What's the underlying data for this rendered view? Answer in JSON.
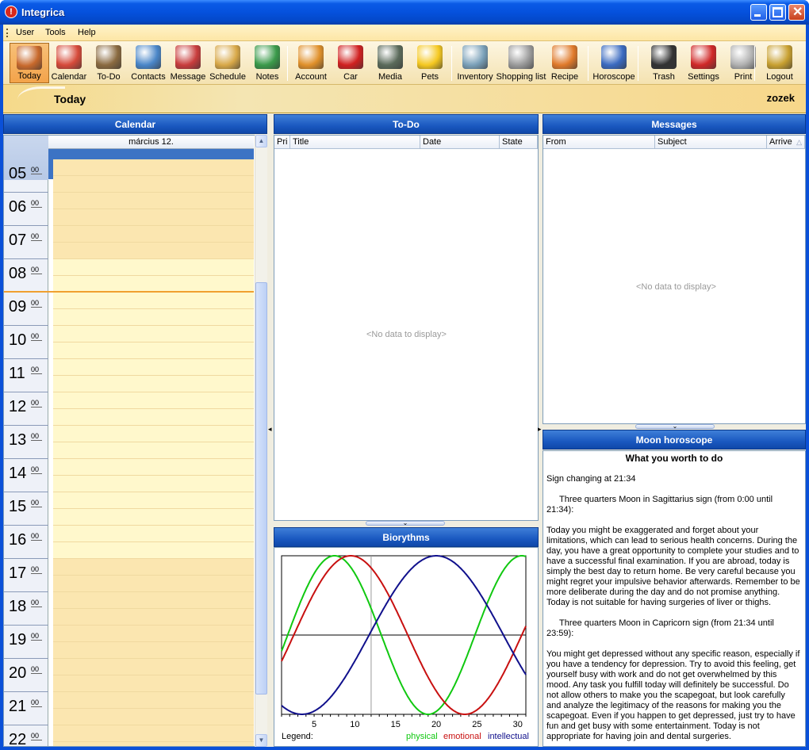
{
  "window": {
    "title": "Integrica"
  },
  "menu": [
    "User",
    "Tools",
    "Help"
  ],
  "toolbar": [
    {
      "label": "Today",
      "icon": "calendar-today-icon",
      "color": "#c8692c"
    },
    {
      "label": "Calendar",
      "icon": "calendar-icon",
      "color": "#d64a3a"
    },
    {
      "label": "To-Do",
      "icon": "todo-icon",
      "color": "#8a6a40"
    },
    {
      "label": "Contacts",
      "icon": "contacts-icon",
      "color": "#4a86c8"
    },
    {
      "label": "Message",
      "icon": "message-icon",
      "color": "#c83c3c"
    },
    {
      "label": "Schedule",
      "icon": "schedule-icon",
      "color": "#d8a848"
    },
    {
      "label": "Notes",
      "icon": "notes-icon",
      "color": "#3a9a4a"
    },
    {
      "label": "Account",
      "icon": "account-icon",
      "color": "#e0902a"
    },
    {
      "label": "Car",
      "icon": "car-icon",
      "color": "#d02020"
    },
    {
      "label": "Media",
      "icon": "media-icon",
      "color": "#5a6a5a"
    },
    {
      "label": "Pets",
      "icon": "pets-icon",
      "color": "#f5c820"
    },
    {
      "label": "Inventory",
      "icon": "inventory-icon",
      "color": "#7aa0b8"
    },
    {
      "label": "Shopping list",
      "icon": "shopping-list-icon",
      "color": "#9a9a9a"
    },
    {
      "label": "Recipe",
      "icon": "recipe-icon",
      "color": "#e07a2a"
    },
    {
      "label": "Horoscope",
      "icon": "horoscope-icon",
      "color": "#3a6ac0"
    },
    {
      "label": "Trash",
      "icon": "trash-icon",
      "color": "#333333"
    },
    {
      "label": "Settings",
      "icon": "settings-icon",
      "color": "#d02828"
    },
    {
      "label": "Print",
      "icon": "print-icon",
      "color": "#b0b0b0"
    },
    {
      "label": "Logout",
      "icon": "logout-icon",
      "color": "#c8a030"
    }
  ],
  "header": {
    "title": "Today",
    "user": "zozek"
  },
  "calendar": {
    "title": "Calendar",
    "date": "március 12.",
    "hours": [
      "05",
      "06",
      "07",
      "08",
      "09",
      "10",
      "11",
      "12",
      "13",
      "14",
      "15",
      "16",
      "17",
      "18",
      "19",
      "20",
      "21",
      "22"
    ],
    "minutes": "00"
  },
  "todo": {
    "title": "To-Do",
    "columns": [
      "Pri",
      "Title",
      "Date",
      "State"
    ],
    "empty": "<No data to display>"
  },
  "messages": {
    "title": "Messages",
    "columns": [
      "From",
      "Subject",
      "Arrive"
    ],
    "empty": "<No data to display>"
  },
  "biorythms": {
    "title": "Biorythms",
    "legend_label": "Legend:",
    "legend": [
      {
        "name": "physical",
        "color": "#10c810"
      },
      {
        "name": "emotional",
        "color": "#c81010"
      },
      {
        "name": "intellectual",
        "color": "#10108c"
      }
    ]
  },
  "chart_data": {
    "type": "line",
    "title": "Biorythms",
    "x": [
      1,
      31
    ],
    "xticks": [
      5,
      10,
      15,
      20,
      25,
      30
    ],
    "ylim": [
      -1,
      1
    ],
    "current_day": 12,
    "series": [
      {
        "name": "physical",
        "period": 23,
        "peak_day": 7.5
      },
      {
        "name": "emotional",
        "period": 28,
        "peak_day": 9.5
      },
      {
        "name": "intellectual",
        "period": 33,
        "peak_day": 20
      }
    ]
  },
  "moon": {
    "title": "Moon horoscope",
    "heading": "What you worth to do",
    "sign_change": "Sign changing at  21:34",
    "phase1": "Three quarters Moon in Sagittarius sign (from 0:00 until 21:34):",
    "text1": "Today you might be exaggerated and forget about your limitations, which can lead to serious health concerns. During the day, you have a great opportunity to complete your studies and to have a successful final examination. If you are abroad, today is simply the best day to return home. Be very careful because you might regret your impulsive behavior afterwards. Remember to be more deliberate during the day and do not promise anything. Today is not suitable for having surgeries of liver or thighs.",
    "phase2": "Three quarters Moon in Capricorn sign (from 21:34 until 23:59):",
    "text2": "You might get depressed without any specific reason, especially if you have a tendency for depression. Try to avoid this feeling, get yourself busy with work and do not get overwhelmed by this mood. Any task you fulfill today will definitely be successful. Do not allow others to make you the scapegoat, but look carefully and analyze the legitimacy of the reasons for making you the scapegoat. Even if you happen to get depressed, just try to have fun and get busy with some entertainment. Today is not appropriate for having join and dental surgeries."
  }
}
